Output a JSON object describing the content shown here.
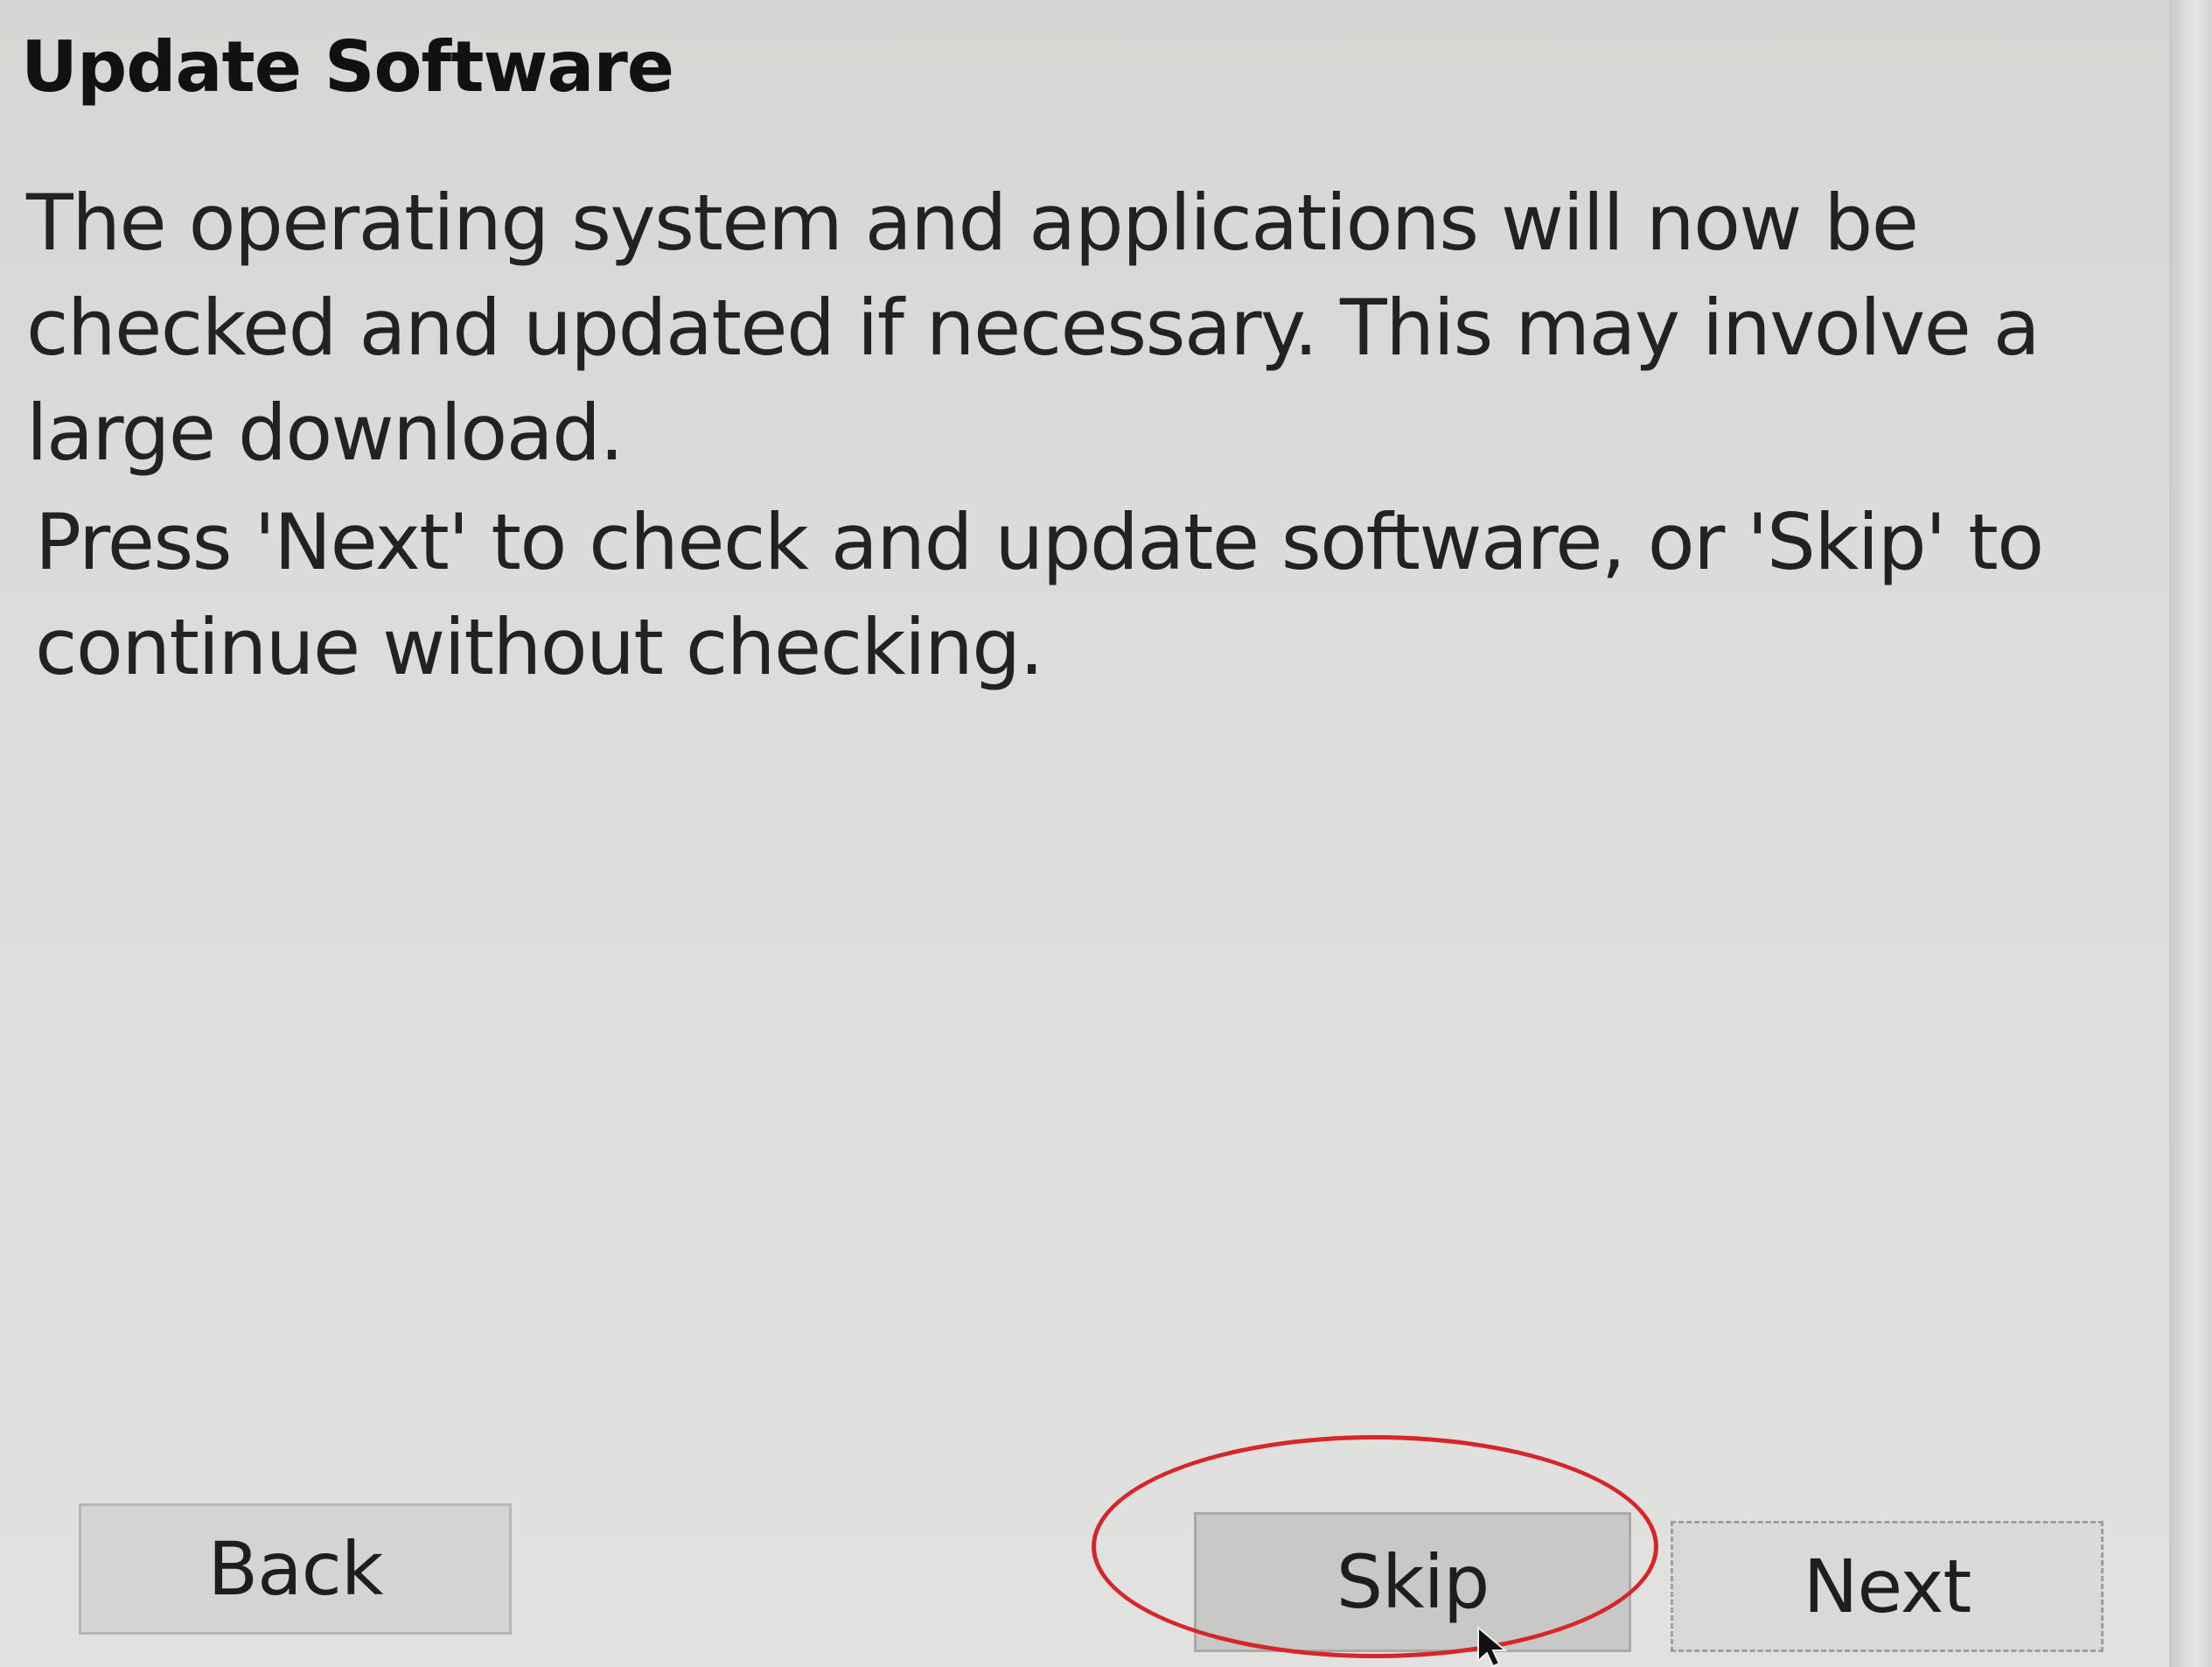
{
  "dialog": {
    "title": "Update Software",
    "paragraph_1": "The operating system and applications will now be checked and updated if necessary. This may involve a large download.",
    "paragraph_2": "Press 'Next' to check and update software, or 'Skip' to continue without checking."
  },
  "buttons": {
    "back_label": "Back",
    "skip_label": "Skip",
    "next_label": "Next"
  },
  "annotation": {
    "highlight_color": "#d6262a",
    "highlight_shape": "ellipse",
    "highlight_target": "skip-button"
  },
  "icons": {
    "cursor": "mouse-pointer-icon"
  },
  "colors": {
    "background": "#dcdddb",
    "text": "#1c1c1c",
    "button": "#cfd0cd"
  }
}
